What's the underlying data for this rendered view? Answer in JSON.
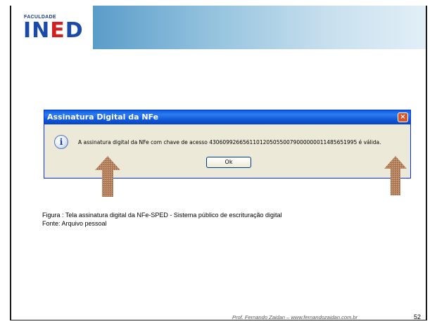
{
  "header": {
    "logo_small": "FACULDADE",
    "logo_main_part1": "IN",
    "logo_main_part2": "E",
    "logo_main_part3": "D"
  },
  "dialog": {
    "title": "Assinatura Digital da NFe",
    "close_label": "×",
    "info_icon_glyph": "i",
    "message": "A assinatura digital da NFe com chave de acesso 43060992665611012050550079000000011485651995 é válida.",
    "ok_label": "Ok"
  },
  "caption": {
    "line1": "Figura : Tela assinatura digital da NFe-SPED - Sistema público de escrituração digital",
    "line2": "Fonte: Arquivo pessoal"
  },
  "footer": {
    "author": "Prof. Fernando Zaidan – www.fernandozaidan.com.br",
    "page_number": "52"
  },
  "colors": {
    "titlebar": "#0a5fde",
    "arrow": "#b07a55",
    "band": "#5a9cc9"
  }
}
